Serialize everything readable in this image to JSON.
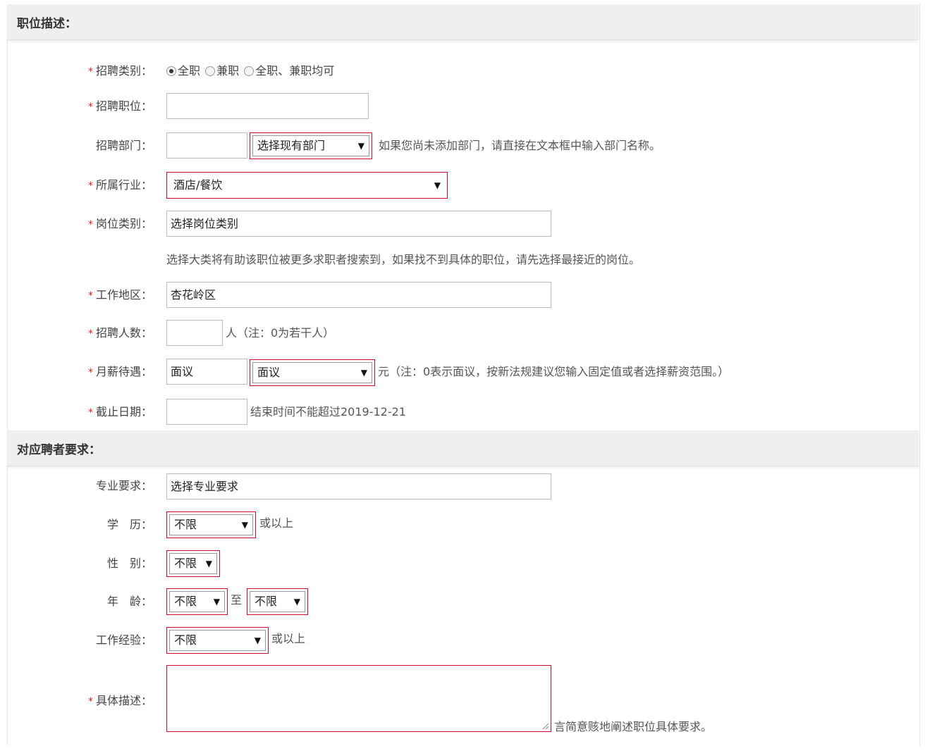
{
  "sections": {
    "job_desc_title": "职位描述：",
    "requirements_title": "对应聘者要求："
  },
  "fields": {
    "recruit_type": {
      "label": "招聘类别：",
      "options": [
        "全职",
        "兼职",
        "全职、兼职均可"
      ],
      "selected": "全职"
    },
    "position": {
      "label": "招聘职位：",
      "value": ""
    },
    "department": {
      "label": "招聘部门：",
      "value": "",
      "select_value": "选择现有部门",
      "hint": "如果您尚未添加部门，请直接在文本框中输入部门名称。"
    },
    "industry": {
      "label": "所属行业：",
      "value": "酒店/餐饮"
    },
    "job_category": {
      "label": "岗位类别：",
      "value": "选择岗位类别",
      "hint": "选择大类将有助该职位被更多求职者搜索到，如果找不到具体的职位，请先选择最接近的岗位。"
    },
    "work_area": {
      "label": "工作地区：",
      "value": "杏花岭区"
    },
    "headcount": {
      "label": "招聘人数：",
      "value": "",
      "hint": "人（注：0为若干人）"
    },
    "salary": {
      "label": "月薪待遇：",
      "value": "面议",
      "select_value": "面议",
      "hint": "元（注：0表示面议，按新法规建议您输入固定值或者选择薪资范围。）"
    },
    "deadline": {
      "label": "截止日期：",
      "value": "",
      "hint": "结束时间不能超过2019-12-21"
    },
    "major": {
      "label": "专业要求：",
      "value": "选择专业要求"
    },
    "education": {
      "label": "学　历：",
      "value": "不限",
      "suffix": "或以上"
    },
    "gender": {
      "label": "性　别：",
      "value": "不限"
    },
    "age": {
      "label": "年　龄：",
      "from": "不限",
      "to": "不限",
      "between": "至"
    },
    "experience": {
      "label": "工作经验：",
      "value": "不限",
      "suffix": "或以上"
    },
    "description": {
      "label": "具体描述：",
      "value": "",
      "hint": "言简意赅地阐述职位具体要求。"
    }
  },
  "required_mark": "*",
  "colors": {
    "required": "#dd2222",
    "select_border": "#c8102e",
    "header_bg": "#efefef"
  },
  "icons": {
    "dropdown": "triangle-down-icon",
    "resize": "resize-grip-icon"
  }
}
